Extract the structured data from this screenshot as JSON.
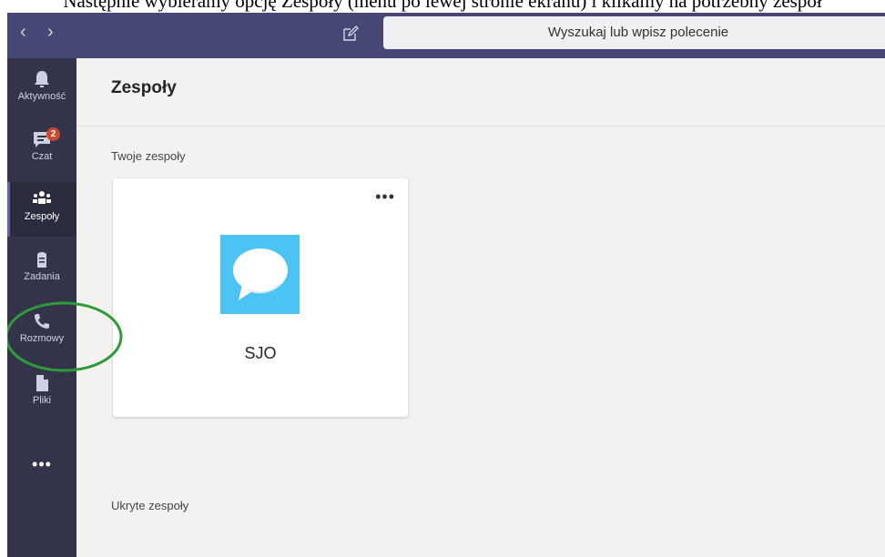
{
  "caption": "Następnie wybieramy opcję Zespoły (menu po lewej stronie ekranu) i klikamy na potrzebny zespół",
  "titlebar": {
    "back_glyph": "‹",
    "forward_glyph": "›",
    "search_placeholder": "Wyszukaj lub wpisz polecenie"
  },
  "rail": {
    "items": [
      {
        "label": "Aktywność",
        "icon": "bell-icon"
      },
      {
        "label": "Czat",
        "icon": "chat-icon",
        "badge": "2"
      },
      {
        "label": "Zespoły",
        "icon": "teams-icon"
      },
      {
        "label": "Zadania",
        "icon": "assignments-icon"
      },
      {
        "label": "Rozmowy",
        "icon": "phone-icon"
      },
      {
        "label": "Pliki",
        "icon": "file-icon"
      }
    ],
    "more": "•••"
  },
  "main": {
    "title": "Zespoły",
    "your_teams_label": "Twoje zespoły",
    "hidden_teams_label": "Ukryte zespoły",
    "teams": [
      {
        "name": "SJO",
        "tile_color": "#4cc3f2",
        "more": "•••"
      }
    ]
  },
  "colors": {
    "titlebar": "#464775",
    "rail": "#33344a",
    "accent": "#6264a7",
    "annotation_circle": "#2e9a3a"
  }
}
